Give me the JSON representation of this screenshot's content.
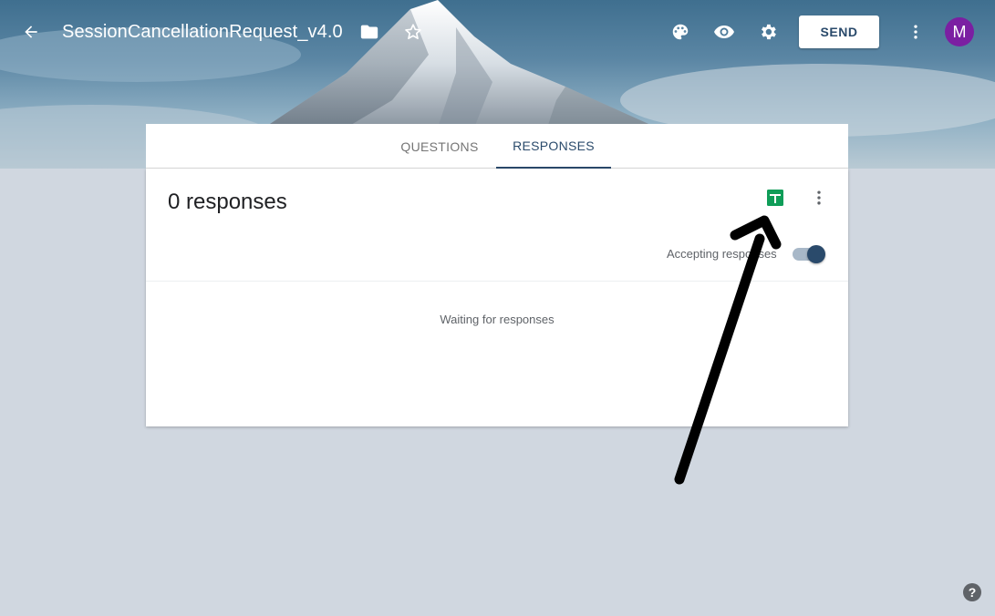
{
  "header": {
    "title": "SessionCancellationRequest_v4.0",
    "send_label": "SEND",
    "avatar_initial": "M",
    "icons": [
      "back-arrow-icon",
      "folder-icon",
      "star-icon",
      "palette-icon",
      "eye-icon",
      "gear-icon",
      "more-vert-icon"
    ]
  },
  "tabs": [
    {
      "label": "QUESTIONS",
      "active": false
    },
    {
      "label": "RESPONSES",
      "active": true
    }
  ],
  "responses": {
    "count_text": "0 responses",
    "accepting_label": "Accepting responses",
    "accepting_on": true,
    "waiting_text": "Waiting for responses",
    "sheets_icon": "sheets-icon"
  },
  "help_label": "?",
  "colors": {
    "accent": "#2a4a6b",
    "avatar": "#7b1fa2",
    "sheets": "#0f9d58",
    "background": "#d0d7e0"
  }
}
